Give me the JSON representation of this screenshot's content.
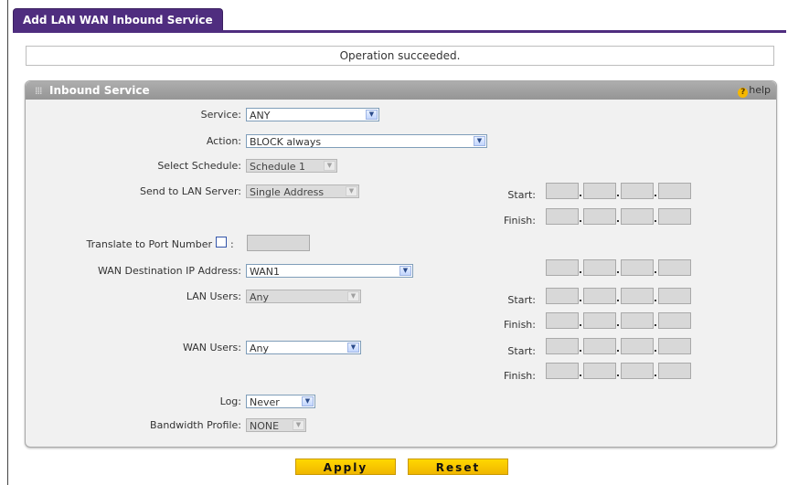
{
  "tab": {
    "label": "Add LAN WAN Inbound Service"
  },
  "status": {
    "message": "Operation succeeded."
  },
  "panel": {
    "title": "Inbound Service",
    "help_label": "help"
  },
  "form": {
    "service": {
      "label": "Service:",
      "value": "ANY"
    },
    "action": {
      "label": "Action:",
      "value": "BLOCK always"
    },
    "schedule": {
      "label": "Select Schedule:",
      "value": "Schedule 1"
    },
    "send_to_lan_server": {
      "label": "Send to LAN Server:",
      "value": "Single Address"
    },
    "translate_port": {
      "label": "Translate to Port Number",
      "colon": ":",
      "checked": false,
      "value": ""
    },
    "wan_dest_ip": {
      "label": "WAN Destination IP Address:",
      "value": "WAN1"
    },
    "lan_users": {
      "label": "LAN Users:",
      "value": "Any"
    },
    "wan_users": {
      "label": "WAN Users:",
      "value": "Any"
    },
    "log": {
      "label": "Log:",
      "value": "Never"
    },
    "bandwidth_profile": {
      "label": "Bandwidth Profile:",
      "value": "NONE"
    }
  },
  "ip_labels": {
    "start": "Start:",
    "finish": "Finish:"
  },
  "buttons": {
    "apply": "Apply",
    "reset": "Reset"
  },
  "colors": {
    "tab_purple": "#4f2d7f",
    "button_yellow": "#ffd800",
    "panel_gray": "#f1f1f1"
  }
}
